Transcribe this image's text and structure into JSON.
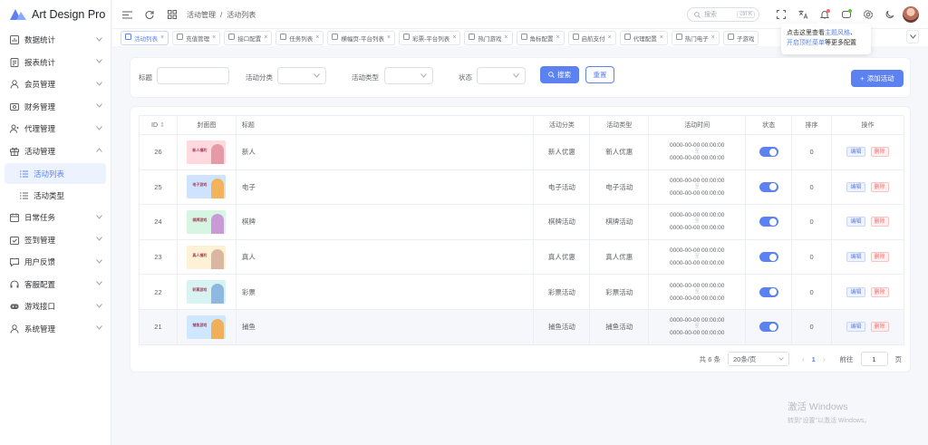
{
  "app": {
    "title": "Art Design Pro"
  },
  "sidebar": {
    "items": [
      {
        "label": "数据统计",
        "icon": "chart-icon"
      },
      {
        "label": "报表统计",
        "icon": "report-icon"
      },
      {
        "label": "会员管理",
        "icon": "user-icon"
      },
      {
        "label": "财务管理",
        "icon": "finance-icon"
      },
      {
        "label": "代理管理",
        "icon": "agent-icon"
      },
      {
        "label": "活动管理",
        "icon": "gift-icon",
        "expanded": true
      },
      {
        "label": "日常任务",
        "icon": "calendar-icon"
      },
      {
        "label": "签到管理",
        "icon": "checkin-icon"
      },
      {
        "label": "用户反馈",
        "icon": "feedback-icon"
      },
      {
        "label": "客服配置",
        "icon": "headset-icon"
      },
      {
        "label": "游戏接口",
        "icon": "gamepad-icon"
      },
      {
        "label": "系统管理",
        "icon": "system-user-icon"
      }
    ],
    "sub_items": [
      {
        "label": "活动列表",
        "active": true
      },
      {
        "label": "活动类型",
        "active": false
      }
    ]
  },
  "header": {
    "breadcrumb": [
      "活动管理",
      "活动列表"
    ],
    "search_placeholder": "搜索",
    "search_kbd": "ctrl K"
  },
  "tabs": [
    {
      "label": "活动列表",
      "active": true
    },
    {
      "label": "充值管理"
    },
    {
      "label": "接口配置"
    },
    {
      "label": "任务列表"
    },
    {
      "label": "横幅页-平台列表"
    },
    {
      "label": "彩票-平台列表"
    },
    {
      "label": "热门游戏"
    },
    {
      "label": "角标配置"
    },
    {
      "label": "启航支付"
    },
    {
      "label": "代理配置"
    },
    {
      "label": "热门电子"
    },
    {
      "label": "子游戏"
    }
  ],
  "popover": {
    "line1_prefix": "点击这里查看",
    "line1_link": "主题风格",
    "line1_suffix": "、",
    "line2_link": "开启顶栏菜单",
    "line2_suffix": "等更多配置"
  },
  "filters": {
    "title_label": "标题",
    "category_label": "活动分类",
    "type_label": "活动类型",
    "status_label": "状态",
    "search_button": "搜索",
    "reset_button": "重置",
    "add_button": "添加活动"
  },
  "table": {
    "columns": [
      "ID",
      "封面图",
      "标题",
      "活动分类",
      "活动类型",
      "活动时间",
      "状态",
      "排序",
      "操作"
    ],
    "rows": [
      {
        "id": "26",
        "title": "新人",
        "category": "新人优惠",
        "type": "新人优惠",
        "start": "0000-00-00 00:00:00",
        "sep": "至",
        "end": "0000-00-00 00:00:00",
        "sort": "0",
        "cover_caption": "新人福利",
        "cover_color": "#ffd9de",
        "cover_figure": "#e59aa8"
      },
      {
        "id": "25",
        "title": "电子",
        "category": "电子活动",
        "type": "电子活动",
        "start": "0000-00-00 00:00:00",
        "sep": "至",
        "end": "0000-00-00 00:00:00",
        "sort": "0",
        "cover_caption": "电子游戏",
        "cover_color": "#cfe3ff",
        "cover_figure": "#f2b35a"
      },
      {
        "id": "24",
        "title": "棋牌",
        "category": "棋牌活动",
        "type": "棋牌活动",
        "start": "0000-00-00 00:00:00",
        "sep": "至",
        "end": "0000-00-00 00:00:00",
        "sort": "0",
        "cover_caption": "棋牌游戏",
        "cover_color": "#d6f5e3",
        "cover_figure": "#c89bd6"
      },
      {
        "id": "23",
        "title": "真人",
        "category": "真人优惠",
        "type": "真人优惠",
        "start": "0000-00-00 00:00:00",
        "sep": "至",
        "end": "0000-00-00 00:00:00",
        "sort": "0",
        "cover_caption": "真人福利",
        "cover_color": "#fff1d6",
        "cover_figure": "#d9b7a3"
      },
      {
        "id": "22",
        "title": "彩票",
        "category": "彩票活动",
        "type": "彩票活动",
        "start": "0000-00-00 00:00:00",
        "sep": "至",
        "end": "0000-00-00 00:00:00",
        "sort": "0",
        "cover_caption": "彩票游戏",
        "cover_color": "#d7f4f2",
        "cover_figure": "#8fb8e0"
      },
      {
        "id": "21",
        "title": "捕鱼",
        "category": "捕鱼活动",
        "type": "捕鱼活动",
        "start": "0000-00-00 00:00:00",
        "sep": "至",
        "end": "0000-00-00 00:00:00",
        "sort": "0",
        "cover_caption": "捕鱼游戏",
        "cover_color": "#cfe8ff",
        "cover_figure": "#f0b05a"
      }
    ],
    "edit_label": "编辑",
    "delete_label": "删除"
  },
  "pagination": {
    "total": "共 6 条",
    "page_size": "20条/页",
    "current": "1",
    "goto_label": "前往",
    "goto_value": "1",
    "page_unit": "页"
  },
  "watermark": {
    "line1": "激活 Windows",
    "line2": "转到\"设置\"以激活 Windows。"
  },
  "colors": {
    "accent": "#5b82f0",
    "danger": "#f56c6c"
  }
}
